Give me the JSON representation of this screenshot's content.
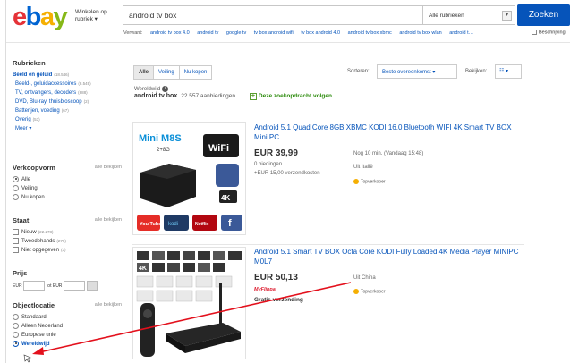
{
  "header": {
    "logo": {
      "e": "e",
      "b": "b",
      "a": "a",
      "y": "y"
    },
    "shop_by_category": "Winkelen op rubriek ▾",
    "search_value": "android tv box",
    "category_select": "Alle rubrieken",
    "search_button": "Zoeken",
    "related_label": "Verwant:",
    "related": [
      "android tv box 4.0",
      "android tv",
      "google tv",
      "tv box android wifi",
      "tv box android 4.0",
      "android tv box xbmc",
      "android tv box wlan",
      "android t…"
    ],
    "advanced": "Beschrijving"
  },
  "sidebar": {
    "categories_title": "Rubrieken",
    "categories": [
      {
        "label": "Beeld en geluid",
        "count": "(18.546)"
      },
      {
        "label": "Beeld-, geluidaccessoires",
        "count": "(8.549)"
      },
      {
        "label": "TV, ontvangers, decoders",
        "count": "(888)"
      },
      {
        "label": "DVD, Blu-ray, thuisbioscoop",
        "count": "(2)"
      },
      {
        "label": "Batterijen, voeding",
        "count": "(67)"
      },
      {
        "label": "Overig",
        "count": "(53)"
      }
    ],
    "more": "Meer ▾",
    "format_title": "Verkoopvorm",
    "see_all": "alle bekijken",
    "formats": [
      "Alle",
      "Veiling",
      "Nu kopen"
    ],
    "condition_title": "Staat",
    "conditions": [
      {
        "label": "Nieuw",
        "count": "(22.278)"
      },
      {
        "label": "Tweedehands",
        "count": "(276)"
      },
      {
        "label": "Niet opgegeven",
        "count": "(3)"
      }
    ],
    "price_title": "Prijs",
    "price_from": "EUR",
    "price_to": "tot EUR",
    "location_title": "Objectlocatie",
    "locations": [
      "Standaard",
      "Alleen Nederland",
      "Europese unie",
      "Wereldwijd"
    ]
  },
  "main": {
    "tabs": [
      "Alle",
      "Veiling",
      "Nu kopen"
    ],
    "sort_label": "Sorteren:",
    "sort_value": "Beste overeenkomst ▾",
    "view_label": "Bekijken:",
    "view_value": "☷ ▾",
    "region": "Wereldwijd",
    "query": "android tv box",
    "result_count": "22.557 aanbiedingen",
    "follow": "Deze zoekopdracht volgen"
  },
  "items": [
    {
      "title": "Android 5.1 Quad Core 8GB XBMC KODI 16.0 Bluetooth WIFI 4K Smart TV BOX Mini PC",
      "price": "EUR 39,99",
      "bids": "0 biedingen",
      "shipping": "+EUR 15,00 verzendkosten",
      "timeleft": "Nog 10 min. (Vandaag 15:48)",
      "location": "Uit Italië",
      "badge": "Topverkoper",
      "thumb_title": "Mini M8S",
      "thumb_sub": "2+8G",
      "thumb_wifi": "WiFi",
      "thumb_4k": "4K",
      "thumb_logos": [
        "You Tube",
        "kodi",
        "Netflix",
        "f"
      ]
    },
    {
      "title": "Android 5.1 Smart TV BOX Octa Core KODI Fully Loaded 4K Media Player MINIPC M0L7",
      "price": "EUR 50,13",
      "brand": "MyFlippa",
      "shipping": "Gratis verzending",
      "location": "Uit China",
      "badge": "Topverkoper",
      "thumb_4k": "4K"
    }
  ],
  "colors": {
    "link": "#0654ba",
    "button": "#0654ba",
    "accent_red": "#dd1e31",
    "green": "#2a8a0a",
    "arrow": "#e3101c"
  }
}
